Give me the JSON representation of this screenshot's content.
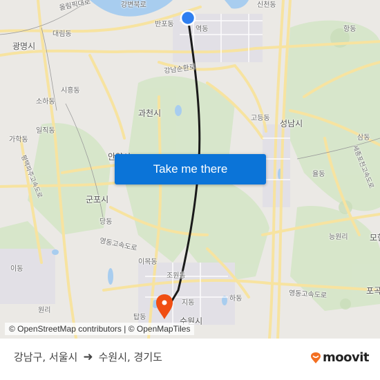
{
  "map": {
    "labels": [
      {
        "text": "올림픽대로",
        "kind": "road"
      },
      {
        "text": "강변북로",
        "kind": "road"
      },
      {
        "text": "신천동",
        "kind": "area"
      },
      {
        "text": "반포동",
        "kind": "area"
      },
      {
        "text": "역동",
        "kind": "area"
      },
      {
        "text": "대림동",
        "kind": "area"
      },
      {
        "text": "광명시",
        "kind": "city"
      },
      {
        "text": "항동",
        "kind": "area"
      },
      {
        "text": "강남순환로",
        "kind": "road"
      },
      {
        "text": "시흥동",
        "kind": "area"
      },
      {
        "text": "소하동",
        "kind": "area"
      },
      {
        "text": "과천시",
        "kind": "city"
      },
      {
        "text": "고등동",
        "kind": "area"
      },
      {
        "text": "성남시",
        "kind": "city"
      },
      {
        "text": "일직동",
        "kind": "area"
      },
      {
        "text": "가학동",
        "kind": "area"
      },
      {
        "text": "삼동",
        "kind": "area"
      },
      {
        "text": "안양시",
        "kind": "city"
      },
      {
        "text": "평택파주고속도로",
        "kind": "road"
      },
      {
        "text": "율동",
        "kind": "area"
      },
      {
        "text": "세종포천고속도로",
        "kind": "road"
      },
      {
        "text": "군포시",
        "kind": "city"
      },
      {
        "text": "당동",
        "kind": "area"
      },
      {
        "text": "능원리",
        "kind": "area"
      },
      {
        "text": "영동고속도로",
        "kind": "road"
      },
      {
        "text": "이목동",
        "kind": "area"
      },
      {
        "text": "이동",
        "kind": "area"
      },
      {
        "text": "조원동",
        "kind": "area"
      },
      {
        "text": "하동",
        "kind": "area"
      },
      {
        "text": "영동고속도로",
        "kind": "road"
      },
      {
        "text": "지동",
        "kind": "area"
      },
      {
        "text": "원리",
        "kind": "area"
      },
      {
        "text": "탑동",
        "kind": "area"
      },
      {
        "text": "수원시",
        "kind": "city"
      },
      {
        "text": "포곡",
        "kind": "area"
      },
      {
        "text": "모현",
        "kind": "area"
      }
    ],
    "origin_marker_icon": "origin-dot-icon",
    "destination_marker_icon": "map-pin-icon",
    "route_color": "#1a1a1a",
    "origin_color": "#2f7ff0",
    "destination_color": "#f04e12"
  },
  "cta": {
    "label": "Take me there",
    "color": "#0b74d8"
  },
  "attribution": "© OpenStreetMap contributors | © OpenMapTiles",
  "footer": {
    "origin": "강남구, 서울시",
    "arrow_icon": "arrow-right-icon",
    "destination": "수원시, 경기도",
    "brand": "moovit",
    "brand_color": "#f36f21"
  }
}
